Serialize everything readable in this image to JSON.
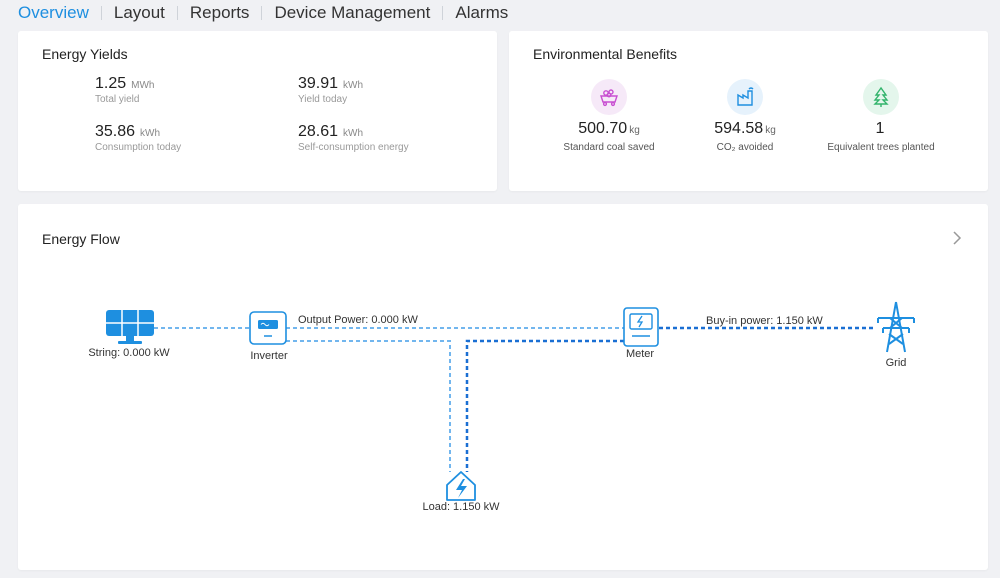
{
  "tabs": [
    {
      "label": "Overview",
      "active": true
    },
    {
      "label": "Layout"
    },
    {
      "label": "Reports"
    },
    {
      "label": "Device Management"
    },
    {
      "label": "Alarms"
    }
  ],
  "energy_yields": {
    "title": "Energy Yields",
    "items": [
      {
        "value": "1.25",
        "unit": "MWh",
        "label": "Total yield"
      },
      {
        "value": "39.91",
        "unit": "kWh",
        "label": "Yield today"
      },
      {
        "value": "35.86",
        "unit": "kWh",
        "label": "Consumption today"
      },
      {
        "value": "28.61",
        "unit": "kWh",
        "label": "Self-consumption energy"
      }
    ]
  },
  "environmental_benefits": {
    "title": "Environmental Benefits",
    "items": [
      {
        "value": "500.70",
        "unit": "kg",
        "label": "Standard coal saved",
        "icon": "coal-cart-icon",
        "color": "#c84fd1",
        "bg": "#f6e9f8"
      },
      {
        "value": "594.58",
        "unit": "kg",
        "label": "CO₂ avoided",
        "icon": "factory-icon",
        "color": "#1e8fe0",
        "bg": "#e6f2fc"
      },
      {
        "value": "1",
        "unit": "",
        "label": "Equivalent trees planted",
        "icon": "tree-icon",
        "color": "#31b36b",
        "bg": "#e4f6ec"
      }
    ]
  },
  "energy_flow": {
    "title": "Energy Flow",
    "string_label": "String: 0.000 kW",
    "inverter_label": "Inverter",
    "meter_label": "Meter",
    "grid_label": "Grid",
    "load_label": "Load: 1.150 kW",
    "output_power": "Output Power: 0.000 kW",
    "buyin_power": "Buy-in power: 1.150 kW"
  },
  "colors": {
    "accent": "#1e8fe0",
    "flow_light": "#72b6ee",
    "flow_dark": "#1a6fd3"
  }
}
